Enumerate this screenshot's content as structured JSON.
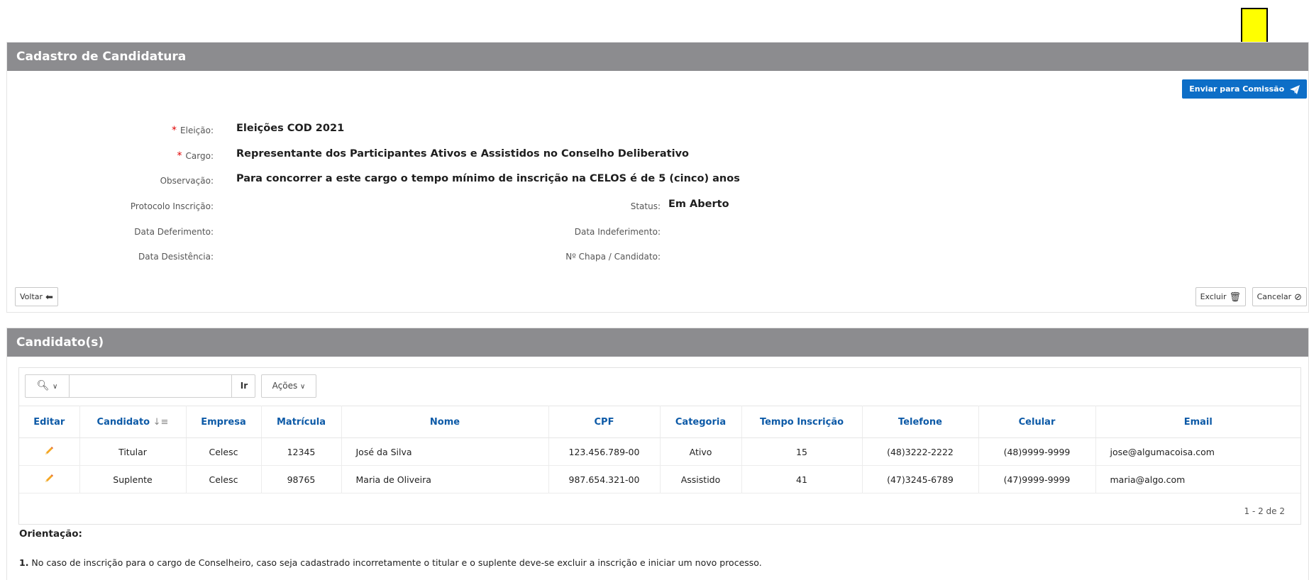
{
  "cadastro": {
    "title": "Cadastro de Candidatura",
    "send_button": "Enviar para Comissão",
    "fields": {
      "eleicao_label": "Eleição:",
      "eleicao_value": "Eleições COD 2021",
      "cargo_label": "Cargo:",
      "cargo_value": "Representante dos Participantes Ativos e Assistidos no Conselho Deliberativo",
      "observacao_label": "Observação:",
      "observacao_value": "Para concorrer a este cargo o tempo mínimo de inscrição na CELOS é de 5 (cinco) anos",
      "protocolo_label": "Protocolo Inscrição:",
      "status_label": "Status:",
      "status_value": "Em Aberto",
      "deferimento_label": "Data Deferimento:",
      "indeferimento_label": "Data Indeferimento:",
      "desistencia_label": "Data Desistência:",
      "chapa_label": "Nº Chapa / Candidato:"
    },
    "required_marker": "*",
    "voltar_button": "Voltar",
    "excluir_button": "Excluir",
    "cancelar_button": "Cancelar"
  },
  "candidatos": {
    "title": "Candidato(s)",
    "search_placeholder": "",
    "go_button": "Ir",
    "acoes_button": "Ações",
    "columns": [
      "Editar",
      "Candidato",
      "Empresa",
      "Matrícula",
      "Nome",
      "CPF",
      "Categoria",
      "Tempo Inscrição",
      "Telefone",
      "Celular",
      "Email"
    ],
    "rows": [
      {
        "candidato": "Titular",
        "empresa": "Celesc",
        "matricula": "12345",
        "nome": "José da Silva",
        "cpf": "123.456.789-00",
        "categoria": "Ativo",
        "tempo": "15",
        "telefone": "(48)3222-2222",
        "celular": "(48)9999-9999",
        "email": "jose@algumacoisa.com"
      },
      {
        "candidato": "Suplente",
        "empresa": "Celesc",
        "matricula": "98765",
        "nome": "Maria de Oliveira",
        "cpf": "987.654.321-00",
        "categoria": "Assistido",
        "tempo": "41",
        "telefone": "(47)3245-6789",
        "celular": "(47)9999-9999",
        "email": "maria@algo.com"
      }
    ],
    "pagination": "1 - 2 de 2"
  },
  "orientacao": {
    "title": "Orientação:",
    "item_number": "1.",
    "item_text": " No caso de inscrição para o cargo de Conselheiro, caso seja cadastrado incorretamente o titular e o suplente deve-se excluir a inscrição e iniciar um novo processo."
  },
  "colors": {
    "header_bg": "#8c8c8f",
    "primary": "#0d6ec7",
    "column_header": "#0d5aa7",
    "arrow": "#ffff00"
  }
}
